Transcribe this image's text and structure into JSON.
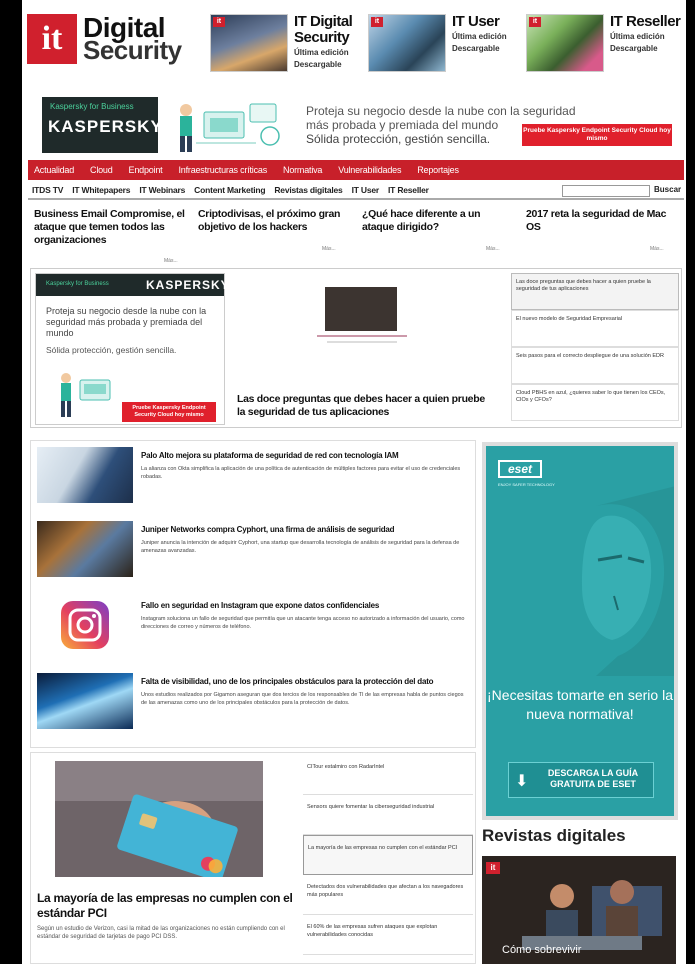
{
  "header": {
    "logo_mark": "it",
    "logo_line1": "Digital",
    "logo_line2": "Security",
    "magazines": [
      {
        "title1": "IT Digital",
        "title2": "Security",
        "sub1": "Última edición",
        "sub2": "Descargable"
      },
      {
        "title1": "IT User",
        "title2": "",
        "sub1": "Última edición",
        "sub2": "Descargable"
      },
      {
        "title1": "IT Reseller",
        "title2": "",
        "sub1": "Última edición",
        "sub2": "Descargable"
      }
    ]
  },
  "banner": {
    "brand_tag": "Kaspersky for Business",
    "brand": "KASPERSKY",
    "line1": "Proteja su negocio desde la nube con la seguridad",
    "line2": "más probada y premiada del mundo",
    "line3": "Sólida protección, gestión sencilla.",
    "cta": "Pruebe Kaspersky Endpoint Security Cloud hoy mismo"
  },
  "nav_primary": [
    "Actualidad",
    "Cloud",
    "Endpoint",
    "Infraestructuras críticas",
    "Normativa",
    "Vulnerabilidades",
    "Reportajes"
  ],
  "nav_secondary": [
    "ITDS TV",
    "IT Whitepapers",
    "IT Webinars",
    "Content Marketing",
    "Revistas digitales",
    "IT User",
    "IT Reseller"
  ],
  "search_button": "Buscar",
  "headlines": [
    "Business Email Compromise, el ataque que temen todos las organizaciones",
    "Criptodivisas, el próximo gran objetivo de los hackers",
    "¿Qué hace diferente a un ataque dirigido?",
    "2017 reta la seguridad de Mac OS"
  ],
  "more_label": "Más...",
  "kasp_ad": {
    "tag": "Kaspersky for Business",
    "brand": "KASPERSKY",
    "text": "Proteja su negocio desde la nube con la seguridad más probada y premiada del mundo",
    "sub": "Sólida protección, gestión sencilla.",
    "cta": "Pruebe Kaspersky Endpoint Security Cloud hoy mismo"
  },
  "featured_title": "Las doce preguntas que debes hacer a quien pruebe la seguridad de tus aplicaciones",
  "side_list": [
    "Las doce preguntas que debes hacer a quien pruebe la seguridad de tus aplicaciones",
    "El nuevo modelo de Seguridad Empresarial",
    "Seis pasos para el correcto despliegue de una solución EDR",
    "Cloud PBHS en azul, ¿quieres saber lo que tienen los CEOs, CIOs y CFOs?"
  ],
  "news": [
    {
      "title": "Palo Alto mejora su plataforma de seguridad de red con tecnología IAM",
      "desc": "La alianza con Okta simplifica la aplicación de una política de autenticación de múltiples factores para evitar el uso de credenciales robadas."
    },
    {
      "title": "Juniper Networks compra Cyphort, una firma de análisis de seguridad",
      "desc": "Juniper anuncia la intención de adquirir Cyphort, una startup que desarrolla tecnología de análisis de seguridad para la defensa de amenazas avanzadas."
    },
    {
      "title": "Fallo en seguridad en Instagram que expone datos confidenciales",
      "desc": "Instagram soluciona un fallo de seguridad que permitía que un atacante tenga acceso no autorizado a información del usuario, como direcciones de correo y números de teléfono."
    },
    {
      "title": "Falta de visibilidad, uno de los principales obstáculos para la protección del dato",
      "desc": "Unos estudios realizados por Gigamon aseguran que dos tercios de los responsables de TI de las empresas habla de puntos ciegos de las amenazas como uno de los principales obstáculos para la protección de datos."
    }
  ],
  "eset": {
    "logo": "eset",
    "tagline": "ENJOY SAFER TECHNOLOGY",
    "headline": "¡Necesitas tomarte en serio la nueva normativa!",
    "cta": "DESCARGA LA GUÍA GRATUITA DE ESET"
  },
  "bottom": {
    "title": "La mayoría de las empresas no cumplen con el estándar PCI",
    "summary": "Según un estudio de Verizon, casi la mitad de las organizaciones no están cumpliendo con el estándar de seguridad de tarjetas de pago PCI DSS.",
    "list": [
      "CITour estalmiro con RadarIntel",
      "Sensors quiere fomentar la ciberseguridad industrial",
      "La mayoría de las empresas no cumplen con el estándar PCI",
      "Detectados dos vulnerabilidades que afectan a los navegadores más populares",
      "El 60% de las empresas sufren ataques que explotan vulnerabilidades conocidas"
    ]
  },
  "revistas": {
    "title": "Revistas digitales",
    "badge": "it",
    "caption": "Cómo sobrevivir"
  },
  "colors": {
    "brand_red": "#c8202a",
    "eset_teal": "#2aa0a4"
  }
}
